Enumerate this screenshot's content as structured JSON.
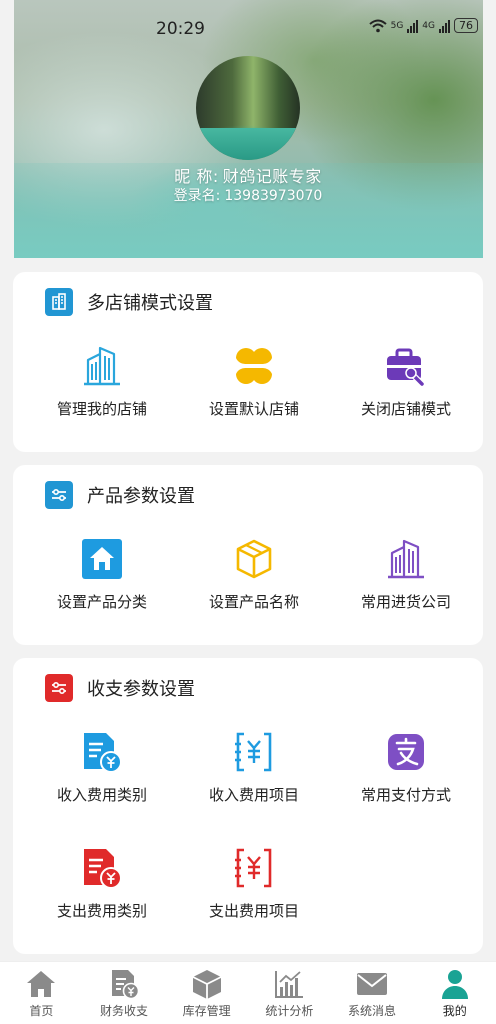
{
  "status_bar": {
    "time": "20:29",
    "net1": "5G",
    "net2": "4G",
    "battery": "76"
  },
  "profile": {
    "nickname_label": "昵 称:",
    "nickname": "财鸽记账专家",
    "login_label": "登录名:",
    "login": "13983973070"
  },
  "sections": [
    {
      "title": "多店铺模式设置",
      "icon": "building-icon",
      "color": "#2196d3",
      "items": [
        {
          "label": "管理我的店铺",
          "icon": "buildings-icon"
        },
        {
          "label": "设置默认店铺",
          "icon": "clover-icon"
        },
        {
          "label": "关闭店铺模式",
          "icon": "toolbox-icon"
        }
      ]
    },
    {
      "title": "产品参数设置",
      "icon": "sliders-icon",
      "color": "#2196d3",
      "items": [
        {
          "label": "设置产品分类",
          "icon": "home-category-icon"
        },
        {
          "label": "设置产品名称",
          "icon": "box-icon"
        },
        {
          "label": "常用进货公司",
          "icon": "company-icon"
        }
      ]
    },
    {
      "title": "收支参数设置",
      "icon": "sliders-icon",
      "color": "#e02a2a",
      "items": [
        {
          "label": "收入费用类别",
          "icon": "income-doc-icon"
        },
        {
          "label": "收入费用项目",
          "icon": "income-item-icon"
        },
        {
          "label": "常用支付方式",
          "icon": "alipay-icon"
        },
        {
          "label": "支出费用类别",
          "icon": "expense-doc-icon"
        },
        {
          "label": "支出费用项目",
          "icon": "expense-item-icon"
        }
      ]
    }
  ],
  "tabbar": {
    "active_index": 5,
    "active_color": "#1aa394",
    "inactive_color": "#8a8a8a",
    "tabs": [
      {
        "label": "首页",
        "icon": "home-icon"
      },
      {
        "label": "财务收支",
        "icon": "finance-doc-icon"
      },
      {
        "label": "库存管理",
        "icon": "inventory-box-icon"
      },
      {
        "label": "统计分析",
        "icon": "chart-icon"
      },
      {
        "label": "系统消息",
        "icon": "mail-icon"
      },
      {
        "label": "我的",
        "icon": "user-icon"
      }
    ]
  }
}
